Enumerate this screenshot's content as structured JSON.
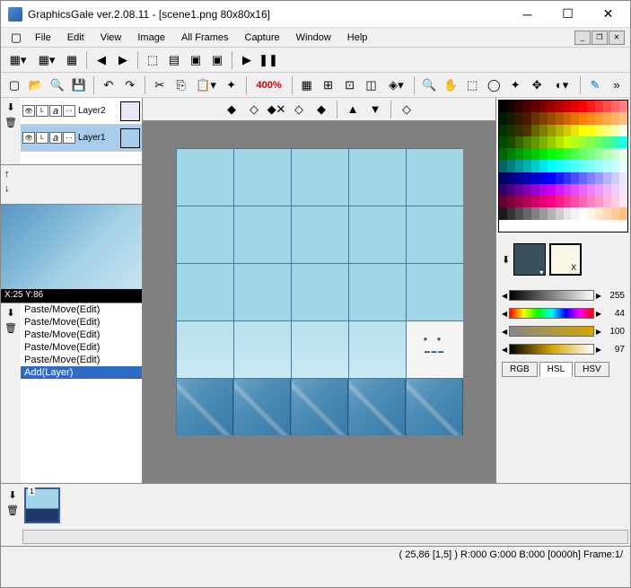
{
  "title": "GraphicsGale ver.2.08.11 - [scene1.png 80x80x16]",
  "menu": [
    "File",
    "Edit",
    "View",
    "Image",
    "All Frames",
    "Capture",
    "Window",
    "Help"
  ],
  "zoom": "400%",
  "layers": [
    {
      "name": "Layer2",
      "selected": false,
      "thumb": "#e8e8f4"
    },
    {
      "name": "Layer1",
      "selected": true,
      "thumb": "#a8ccec"
    }
  ],
  "preview_coord": "X:25 Y:86",
  "history": [
    {
      "label": "Paste/Move(Edit)",
      "sel": false
    },
    {
      "label": "Paste/Move(Edit)",
      "sel": false
    },
    {
      "label": "Paste/Move(Edit)",
      "sel": false
    },
    {
      "label": "Paste/Move(Edit)",
      "sel": false
    },
    {
      "label": "Paste/Move(Edit)",
      "sel": false
    },
    {
      "label": "Add(Layer)",
      "sel": true
    }
  ],
  "sliders": {
    "gray": "255",
    "hue": "44",
    "sat": "100",
    "light": "97"
  },
  "colortabs": [
    "RGB",
    "HSL",
    "HSV"
  ],
  "colortab_active": 1,
  "frame_number": "1",
  "status": "( 25,86 [1,5] ) R:000 G:000 B:000  [0000h]  Frame:1/",
  "palette_colors": [
    "#000000",
    "#1a0000",
    "#330000",
    "#4d0000",
    "#660000",
    "#800000",
    "#990000",
    "#b30000",
    "#cc0000",
    "#e60000",
    "#ff0000",
    "#ff1a1a",
    "#ff3333",
    "#ff4d4d",
    "#ff6666",
    "#ff8080",
    "#001a00",
    "#1a1a00",
    "#331a00",
    "#4d1a00",
    "#663300",
    "#804000",
    "#994d00",
    "#b35900",
    "#cc6600",
    "#e67300",
    "#ff8000",
    "#ff8c1a",
    "#ff9933",
    "#ffa64d",
    "#ffb366",
    "#ffbf80",
    "#003300",
    "#1a3300",
    "#333300",
    "#4d3300",
    "#666600",
    "#808000",
    "#999900",
    "#b3b300",
    "#cccc00",
    "#e6e600",
    "#ffff00",
    "#ffff1a",
    "#ffff4d",
    "#ffff80",
    "#ffffb3",
    "#ffffe6",
    "#004d00",
    "#1a4d00",
    "#336600",
    "#4d8000",
    "#669900",
    "#80b300",
    "#99cc00",
    "#b3e600",
    "#ccff00",
    "#b3ff1a",
    "#99ff33",
    "#80ff4d",
    "#66ff66",
    "#4dff80",
    "#33ffb3",
    "#1affe6",
    "#006600",
    "#008000",
    "#009900",
    "#00b300",
    "#00cc00",
    "#00e600",
    "#00ff00",
    "#1aff1a",
    "#33ff33",
    "#4dff4d",
    "#66ff66",
    "#80ff80",
    "#99ff99",
    "#b3ffb3",
    "#ccffcc",
    "#e6ffe6",
    "#006666",
    "#008080",
    "#009999",
    "#00b3b3",
    "#00cccc",
    "#00e6e6",
    "#00ffff",
    "#1affff",
    "#33ffff",
    "#4dffff",
    "#66ffff",
    "#80ffff",
    "#99ffff",
    "#b3ffff",
    "#ccffff",
    "#e6ffff",
    "#000066",
    "#000080",
    "#000099",
    "#0000b3",
    "#0000cc",
    "#0000e6",
    "#0000ff",
    "#1a1aff",
    "#3333ff",
    "#4d4dff",
    "#6666ff",
    "#8080ff",
    "#9999ff",
    "#b3b3ff",
    "#ccccff",
    "#e6e6ff",
    "#330066",
    "#4d0080",
    "#660099",
    "#8000b3",
    "#9900cc",
    "#b300e6",
    "#cc00ff",
    "#d21aff",
    "#d933ff",
    "#df4dff",
    "#e666ff",
    "#ec80ff",
    "#f299ff",
    "#f2b3ff",
    "#f2ccff",
    "#f2e6ff",
    "#660033",
    "#800040",
    "#99004d",
    "#b30059",
    "#cc0066",
    "#e60073",
    "#ff0080",
    "#ff1a8c",
    "#ff3399",
    "#ff4da6",
    "#ff66b3",
    "#ff80bf",
    "#ff99cc",
    "#ffb3d9",
    "#ffcce6",
    "#ffe6f2",
    "#1a1a1a",
    "#333333",
    "#4d4d4d",
    "#666666",
    "#808080",
    "#999999",
    "#b3b3b3",
    "#cccccc",
    "#e6e6e6",
    "#f2f2f2",
    "#ffffff",
    "#fff5e6",
    "#ffe6cc",
    "#ffd9b3",
    "#ffcc99",
    "#ffbf80",
    "#ffffff",
    "#ffffff",
    "#ffffff",
    "#ffffff",
    "#ffffff",
    "#ffffff",
    "#ffffff",
    "#ffffff",
    "#ffffff",
    "#ffffff",
    "#ffffff",
    "#ffffff",
    "#ffffff",
    "#ffffff",
    "#ffffff",
    "#ffffff"
  ]
}
